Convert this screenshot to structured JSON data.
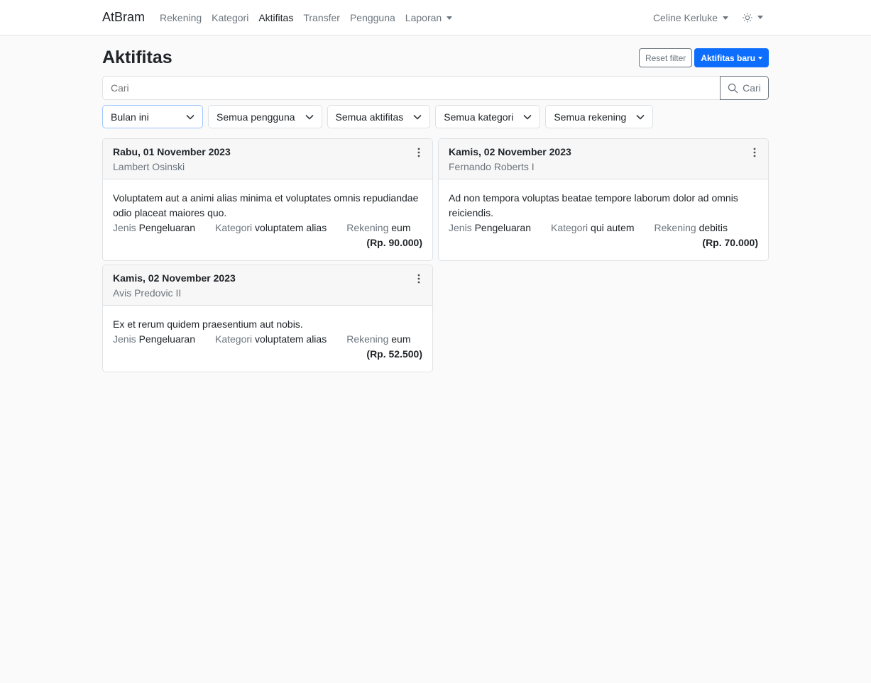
{
  "nav": {
    "brand": "AtBram",
    "links": [
      {
        "label": "Rekening"
      },
      {
        "label": "Kategori"
      },
      {
        "label": "Aktifitas"
      },
      {
        "label": "Transfer"
      },
      {
        "label": "Pengguna"
      },
      {
        "label": "Laporan"
      }
    ],
    "user": "Celine Kerluke",
    "theme_icon": "sun-icon"
  },
  "page": {
    "title": "Aktifitas",
    "reset_filter": "Reset filter",
    "new_activity": "Aktifitas baru"
  },
  "search": {
    "placeholder": "Cari",
    "button": "Cari"
  },
  "filters": [
    {
      "label": "Bulan ini"
    },
    {
      "label": "Semua pengguna"
    },
    {
      "label": "Semua aktifitas"
    },
    {
      "label": "Semua kategori"
    },
    {
      "label": "Semua rekening"
    }
  ],
  "meta_labels": {
    "jenis": "Jenis",
    "kategori": "Kategori",
    "rekening": "Rekening"
  },
  "activities": [
    {
      "date": "Rabu, 01 November 2023",
      "user": "Lambert Osinski",
      "description": "Voluptatem aut a animi alias minima et voluptates omnis repudiandae odio placeat maiores quo.",
      "jenis": "Pengeluaran",
      "kategori": "voluptatem alias",
      "rekening": "eum",
      "amount": "(Rp. 90.000)"
    },
    {
      "date": "Kamis, 02 November 2023",
      "user": "Fernando Roberts I",
      "description": "Ad non tempora voluptas beatae tempore laborum dolor ad omnis reiciendis.",
      "jenis": "Pengeluaran",
      "kategori": "qui autem",
      "rekening": "debitis",
      "amount": "(Rp. 70.000)"
    },
    {
      "date": "Kamis, 02 November 2023",
      "user": "Avis Predovic II",
      "description": "Ex et rerum quidem praesentium aut nobis.",
      "jenis": "Pengeluaran",
      "kategori": "voluptatem alias",
      "rekening": "eum",
      "amount": "(Rp. 52.500)"
    }
  ]
}
